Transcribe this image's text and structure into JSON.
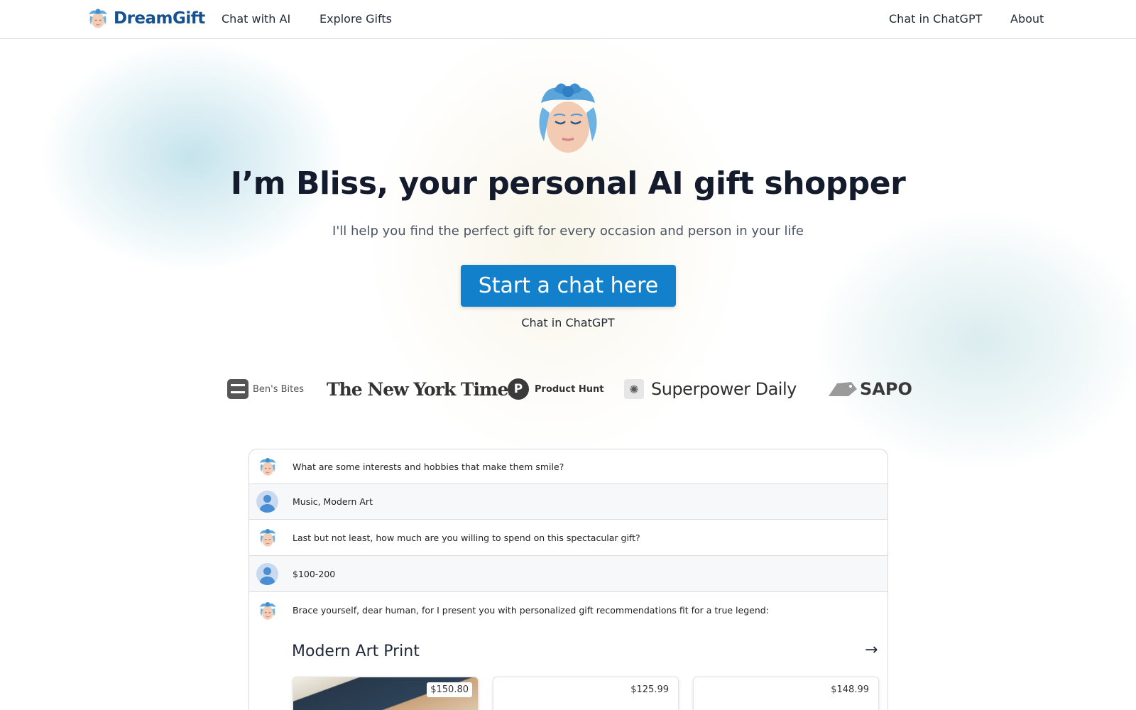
{
  "nav": {
    "brand": "DreamGift",
    "links_left": [
      "Chat with AI",
      "Explore Gifts"
    ],
    "links_right": [
      "Chat in ChatGPT",
      "About"
    ]
  },
  "hero": {
    "title": "I’m Bliss, your personal AI gift shopper",
    "subtitle": "I'll help you find the perfect gift for every occasion and person in your life",
    "cta_label": "Start a chat here",
    "secondary_label": "Chat in ChatGPT"
  },
  "press": {
    "bens_bites": "Ben's Bites",
    "nyt": "The New York Times",
    "product_hunt_letter": "P",
    "product_hunt": "Product Hunt",
    "superpower": "Superpower Daily",
    "sapo": "SAPO"
  },
  "chat": {
    "messages": [
      {
        "role": "bot",
        "text": "What are some interests and hobbies that make them smile?"
      },
      {
        "role": "user",
        "text": "Music, Modern Art"
      },
      {
        "role": "bot",
        "text": "Last but not least, how much are you willing to spend on this spectacular gift?"
      },
      {
        "role": "user",
        "text": "$100-200"
      },
      {
        "role": "bot",
        "text": "Brace yourself, dear human, for I present you with personalized gift recommendations fit for a true legend:"
      }
    ],
    "section_title": "Modern Art Print",
    "section_arrow": "→",
    "products": [
      {
        "price": "$150.80"
      },
      {
        "price": "$125.99"
      },
      {
        "price": "$148.99"
      }
    ]
  },
  "colors": {
    "brand": "#15508f",
    "cta": "#1380cc",
    "title": "#141b2d"
  }
}
